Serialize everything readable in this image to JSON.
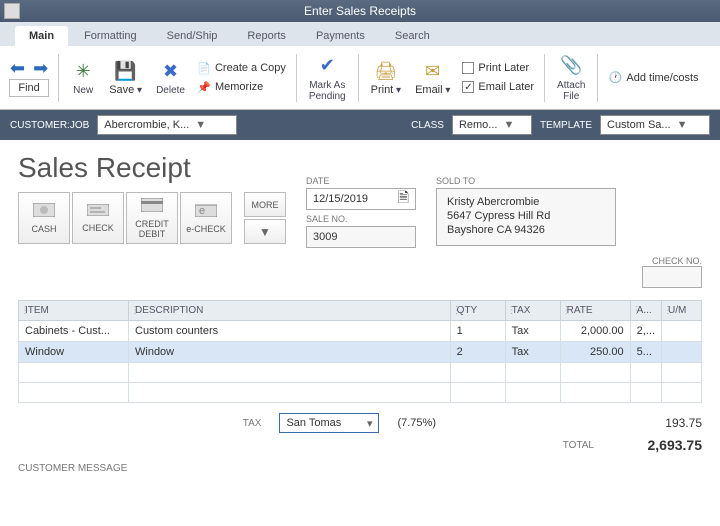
{
  "window_title": "Enter Sales Receipts",
  "tabs": [
    "Main",
    "Formatting",
    "Send/Ship",
    "Reports",
    "Payments",
    "Search"
  ],
  "ribbon": {
    "find": "Find",
    "new": "New",
    "save": "Save",
    "delete": "Delete",
    "create_copy": "Create a Copy",
    "memorize": "Memorize",
    "mark_pending": "Mark As\nPending",
    "print": "Print",
    "email": "Email",
    "print_later": "Print Later",
    "email_later": "Email Later",
    "attach": "Attach\nFile",
    "add_time": "Add time/costs"
  },
  "sel": {
    "cust_lbl": "CUSTOMER:JOB",
    "cust_val": "Abercrombie, K...",
    "class_lbl": "CLASS",
    "class_val": "Remo...",
    "tmpl_lbl": "TEMPLATE",
    "tmpl_val": "Custom Sa..."
  },
  "doc": {
    "title": "Sales Receipt",
    "date_lbl": "DATE",
    "date_val": "12/15/2019",
    "sale_lbl": "SALE NO.",
    "sale_val": "3009",
    "sold_lbl": "SOLD TO",
    "sold_to": "Kristy Abercrombie\n5647 Cypress Hill Rd\nBayshore CA 94326",
    "more": "MORE",
    "check_lbl": "CHECK NO.",
    "pay": {
      "cash": "CASH",
      "check": "CHECK",
      "cd": "CREDIT\nDEBIT",
      "echeck": "e-CHECK"
    }
  },
  "cols": {
    "item": "ITEM",
    "desc": "DESCRIPTION",
    "qty": "QTY",
    "tax": "TAX",
    "rate": "RATE",
    "amt": "A...",
    "um": "U/M"
  },
  "rows": [
    {
      "item": "Cabinets - Cust...",
      "desc": "Custom counters",
      "qty": "1",
      "tax": "Tax",
      "rate": "2,000.00",
      "amt": "2,..."
    },
    {
      "item": "Window",
      "desc": "Window",
      "qty": "2",
      "tax": "Tax",
      "rate": "250.00",
      "amt": "5..."
    }
  ],
  "totals": {
    "tax_lbl": "TAX",
    "tax_name": "San Tomas",
    "tax_pct": "(7.75%)",
    "tax_amt": "193.75",
    "tot_lbl": "TOTAL",
    "tot_amt": "2,693.75"
  },
  "cm": "CUSTOMER MESSAGE"
}
